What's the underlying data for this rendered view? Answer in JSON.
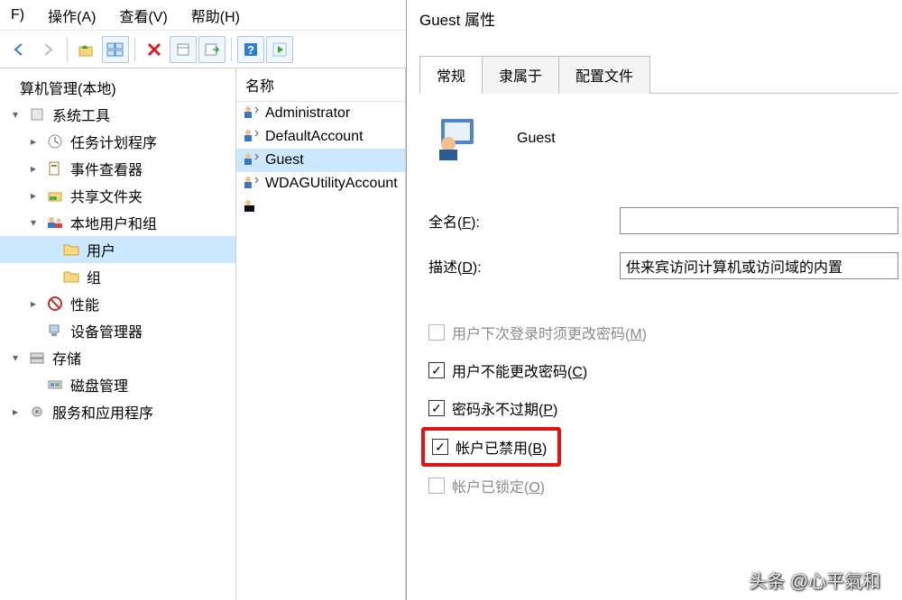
{
  "menu": {
    "file": "F)",
    "action": "操作(A)",
    "view": "查看(V)",
    "help": "帮助(H)"
  },
  "toolbar": {
    "back_icon": "nav-back-icon",
    "forward_icon": "nav-forward-icon",
    "up_icon": "folder-up-icon",
    "props_icon": "window-tile-icon",
    "delete_icon": "delete-x-icon",
    "refresh_icon": "refresh-icon",
    "export_icon": "export-list-icon",
    "help_icon": "help-icon",
    "play_icon": "play-icon"
  },
  "tree": {
    "root": "算机管理(本地)",
    "systools": "系统工具",
    "tasksched": "任务计划程序",
    "eventvwr": "事件查看器",
    "shared": "共享文件夹",
    "localusers": "本地用户和组",
    "users": "用户",
    "groups": "组",
    "perf": "性能",
    "devmgr": "设备管理器",
    "storage": "存储",
    "diskmgmt": "磁盘管理",
    "services": "服务和应用程序"
  },
  "list": {
    "header": "名称",
    "items": [
      {
        "name": "Administrator"
      },
      {
        "name": "DefaultAccount"
      },
      {
        "name": "Guest"
      },
      {
        "name": "WDAGUtilityAccount"
      },
      {
        "name": ""
      }
    ]
  },
  "dialog": {
    "title": "Guest 属性",
    "tabs": {
      "general": "常规",
      "memberof": "隶属于",
      "profile": "配置文件"
    },
    "user_name": "Guest",
    "fullname_label_pre": "全名(",
    "fullname_hot": "F",
    "fullname_label_post": "):",
    "fullname_value": "",
    "desc_label_pre": "描述(",
    "desc_hot": "D",
    "desc_label_post": "):",
    "desc_value": "供来宾访问计算机或访问域的内置",
    "chk1_pre": "用户下次登录时须更改密码(",
    "chk1_hot": "M",
    "chk1_post": ")",
    "chk2_pre": "用户不能更改密码(",
    "chk2_hot": "C",
    "chk2_post": ")",
    "chk3_pre": "密码永不过期(",
    "chk3_hot": "P",
    "chk3_post": ")",
    "chk4_pre": "帐户已禁用(",
    "chk4_hot": "B",
    "chk4_post": ")",
    "chk5_pre": "帐户已锁定(",
    "chk5_hot": "O",
    "chk5_post": ")"
  },
  "watermark": "头条 @心平氣和"
}
